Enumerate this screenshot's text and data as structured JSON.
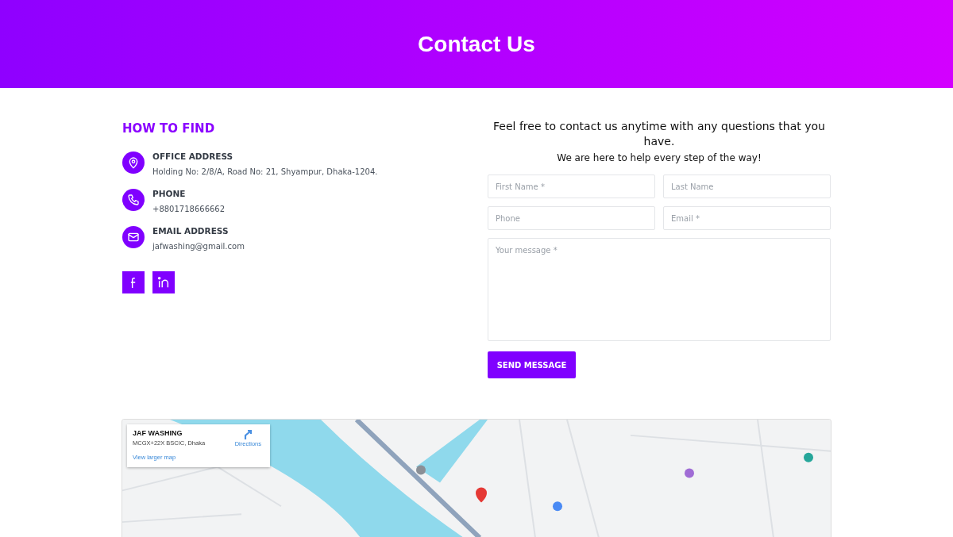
{
  "header": {
    "title": "Contact Us"
  },
  "how_to_find": {
    "heading": "HOW TO FIND",
    "items": [
      {
        "kind": "address",
        "label": "OFFICE ADDRESS",
        "value": "Holding No: 2/8/A, Road No: 21, Shyampur, Dhaka-1204."
      },
      {
        "kind": "phone",
        "label": "PHONE",
        "value": "+8801718666662"
      },
      {
        "kind": "email",
        "label": "EMAIL ADDRESS",
        "value": "jafwashing@gmail.com"
      }
    ],
    "social": [
      {
        "kind": "facebook"
      },
      {
        "kind": "linkedin"
      }
    ]
  },
  "contact_form": {
    "intro": "Feel free to contact us anytime with any questions that you have.",
    "subtitle": "We are here to help every step of the way!",
    "fields": [
      {
        "placeholder": "First Name *"
      },
      {
        "placeholder": "Last Name"
      },
      {
        "placeholder": "Phone"
      },
      {
        "placeholder": "Email *"
      }
    ],
    "message": {
      "placeholder": "Your message *"
    },
    "submit": "SEND MESSAGE"
  },
  "map": {
    "kind": "picture",
    "card": {
      "title": "JAF WASHING",
      "address": "MCGX+22X BSCIC, Dhaka",
      "directions": "Directions",
      "larger_map": "View larger map"
    }
  }
}
